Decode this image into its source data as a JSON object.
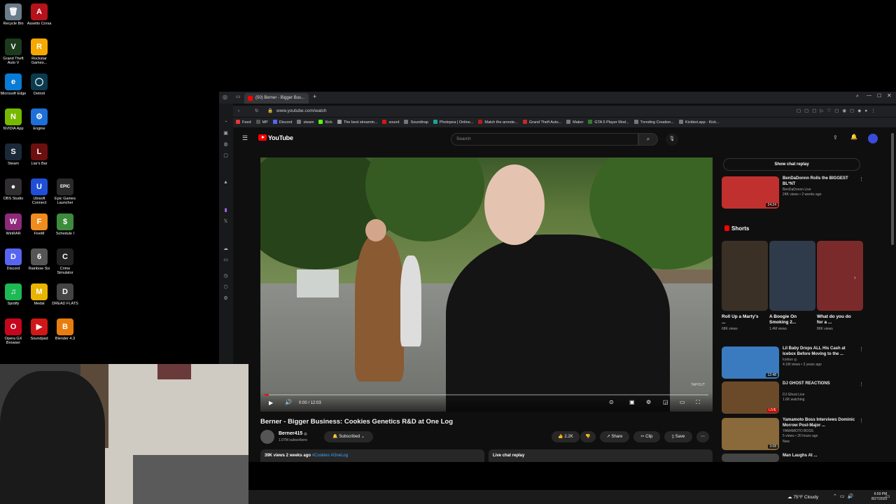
{
  "desktop": {
    "icons": [
      {
        "label": "Recycle Bin",
        "glyph": "🗑",
        "color": "#6a7b8a"
      },
      {
        "label": "Assetto Corsa",
        "glyph": "A",
        "color": "#b5121b"
      },
      {
        "label": "Grand Theft Auto V",
        "glyph": "V",
        "color": "#1c3b1c"
      },
      {
        "label": "Rockstar Games...",
        "glyph": "R",
        "color": "#f6a800"
      },
      {
        "label": "Microsoft Edge",
        "glyph": "e",
        "color": "#0a7bd5"
      },
      {
        "label": "Detroit",
        "glyph": "◯",
        "color": "#0b3a4f"
      },
      {
        "label": "NVIDIA App",
        "glyph": "N",
        "color": "#76b900"
      },
      {
        "label": "Engine",
        "glyph": "⚙",
        "color": "#1e6fd9"
      },
      {
        "label": "Steam",
        "glyph": "S",
        "color": "#1b2838"
      },
      {
        "label": "Liar's Bar",
        "glyph": "L",
        "color": "#6b0f0f"
      },
      {
        "label": "OBS Studio",
        "glyph": "●",
        "color": "#302e31"
      },
      {
        "label": "Ubisoft Connect",
        "glyph": "U",
        "color": "#1f4fd6"
      },
      {
        "label": "Epic Games Launcher",
        "glyph": "EPIC",
        "color": "#2a2a2a"
      },
      {
        "label": "WinRAR",
        "glyph": "W",
        "color": "#8e2a7a"
      },
      {
        "label": "FiveM",
        "glyph": "F",
        "color": "#f08b1d"
      },
      {
        "label": "Schedule I",
        "glyph": "$",
        "color": "#3d8b3d"
      },
      {
        "label": "Discord",
        "glyph": "D",
        "color": "#5865f2"
      },
      {
        "label": "Rainbow Six",
        "glyph": "6",
        "color": "#555"
      },
      {
        "label": "Crime Simulator",
        "glyph": "C",
        "color": "#222"
      },
      {
        "label": "Spotify",
        "glyph": "♫",
        "color": "#1db954"
      },
      {
        "label": "Medal",
        "glyph": "M",
        "color": "#e8b400"
      },
      {
        "label": "DREAD FLATS",
        "glyph": "D",
        "color": "#444"
      },
      {
        "label": "Opera GX Browser",
        "glyph": "O",
        "color": "#c5061d"
      },
      {
        "label": "Soundpad",
        "glyph": "▶",
        "color": "#d01818"
      },
      {
        "label": "Blender 4.3",
        "glyph": "B",
        "color": "#e87d0d"
      }
    ]
  },
  "browser": {
    "tab_title": "(50) Berner - Bigger Bus...",
    "new_tab": "+",
    "url": "www.youtube.com/watch",
    "bookmarks": [
      {
        "label": "Feed",
        "color": "#e53935"
      },
      {
        "label": "MP",
        "color": "#555"
      },
      {
        "label": "Discord",
        "color": "#5865f2"
      },
      {
        "label": "steam",
        "color": "#777"
      },
      {
        "label": "Kick",
        "color": "#53fc18"
      },
      {
        "label": "The best streamin...",
        "color": "#999"
      },
      {
        "label": "sound",
        "color": "#d01818"
      },
      {
        "label": "Soundtrap",
        "color": "#777"
      },
      {
        "label": "Photopea | Online...",
        "color": "#18a497"
      },
      {
        "label": "Match the arreste...",
        "color": "#b71c1c"
      },
      {
        "label": "Grand Theft Auto...",
        "color": "#c62828"
      },
      {
        "label": "Maker",
        "color": "#777"
      },
      {
        "label": "GTA 5 Player Mod...",
        "color": "#2e7d32"
      },
      {
        "label": "Trending Creation...",
        "color": "#777"
      },
      {
        "label": "Kickbot.app - Kick...",
        "color": "#777"
      }
    ]
  },
  "youtube": {
    "logo_text": "YouTube",
    "search_placeholder": "Search",
    "video": {
      "title": "Berner - Bigger Business: Cookies Genetics R&D at One Log",
      "time": "0:00 / 12:03",
      "progress_fraction": 0.01,
      "watermark": "TAPOUT"
    },
    "channel": {
      "name": "Berner415",
      "verified": "◎",
      "subscribers": "1.07M subscribers",
      "subscribed_label": "Subscribed"
    },
    "actions": {
      "likes": "2.2K",
      "share": "Share",
      "clip": "Clip",
      "save": "Save"
    },
    "description": {
      "stats": "39K views  2 weeks ago",
      "tags": "#Cookies #OneLog"
    },
    "live_chat": "Live chat replay",
    "show_chat": "Show chat replay",
    "recommendations": [
      {
        "title": "BenDaDonnn Rolls the BIGGEST BL*NT",
        "channel": "BenDaDonnn Live",
        "meta": "24K views • 2 weeks ago",
        "duration": "24:24",
        "thumb_color": "#c0302f"
      },
      {
        "title": "Lil Baby Drops ALL His Cash at Icebox Before Moving to the ...",
        "channel": "Icebox ◎",
        "meta": "4.1M views • 3 years ago",
        "duration": "12:48",
        "thumb_color": "#3a7bbf"
      },
      {
        "title": "DJ GHOST REACTIONS",
        "channel": "DJ Ghost Live",
        "meta": "1.6K watching",
        "duration": "LIVE",
        "thumb_color": "#6b4a2a"
      },
      {
        "title": "Yamamoto Boss Interviews Dominic Morrow Post-Major ...",
        "channel": "YAMAMOTO BOSS",
        "meta": "5 views • 20 hours ago",
        "duration": "3:08",
        "thumb_color": "#8a6a3a",
        "badge": "New"
      },
      {
        "title": "Man Laughs At ...",
        "channel": "",
        "meta": "",
        "duration": "",
        "thumb_color": "#444"
      }
    ],
    "shorts_heading": "Shorts",
    "shorts": [
      {
        "title": "Roll Up a Marty's ...",
        "views": "68K views",
        "thumb_color": "#3b3026"
      },
      {
        "title": "A Boogie On Smoking 2...",
        "views": "1.4M views",
        "thumb_color": "#2f3a4a"
      },
      {
        "title": "What do you do for a ...",
        "views": "86K views",
        "thumb_color": "#7a2a2a"
      }
    ]
  },
  "taskbar": {
    "weather": "75°F  Cloudy",
    "time": "6:59 PM",
    "date": "8/27/2025"
  }
}
